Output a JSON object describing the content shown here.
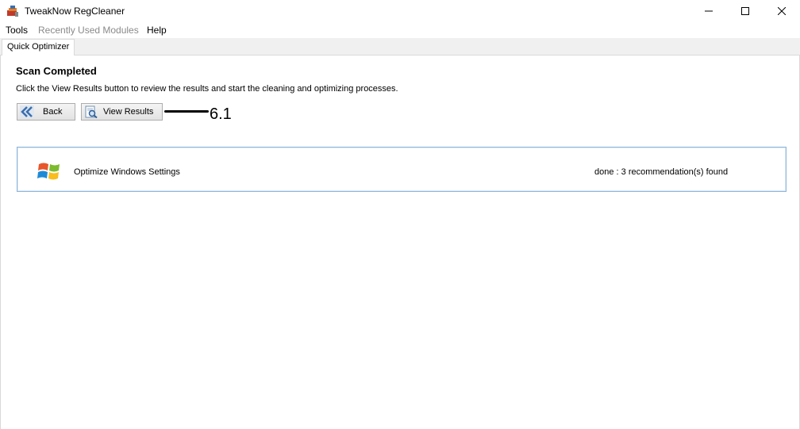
{
  "window": {
    "title": "TweakNow RegCleaner"
  },
  "menubar": {
    "items": [
      {
        "label": "Tools",
        "enabled": true
      },
      {
        "label": "Recently Used Modules",
        "enabled": false
      },
      {
        "label": "Help",
        "enabled": true
      }
    ]
  },
  "tabs": [
    {
      "label": "Quick Optimizer",
      "active": true
    }
  ],
  "main": {
    "heading": "Scan Completed",
    "instruction": "Click the View Results button to review the results and start the cleaning and optimizing processes.",
    "buttons": {
      "back": {
        "label": "Back",
        "icon": "double-chevron-left-icon"
      },
      "view_results": {
        "label": "View Results",
        "icon": "magnifier-document-icon"
      }
    },
    "annotation": "6.1",
    "results": [
      {
        "title": "Optimize Windows Settings",
        "status": "done : 3 recommendation(s) found",
        "icon": "windows-logo-icon"
      }
    ]
  },
  "colors": {
    "panel_border": "#8fb5d8",
    "disabled_text": "#8a8a8a",
    "accent_blue": "#3a6fb0"
  }
}
